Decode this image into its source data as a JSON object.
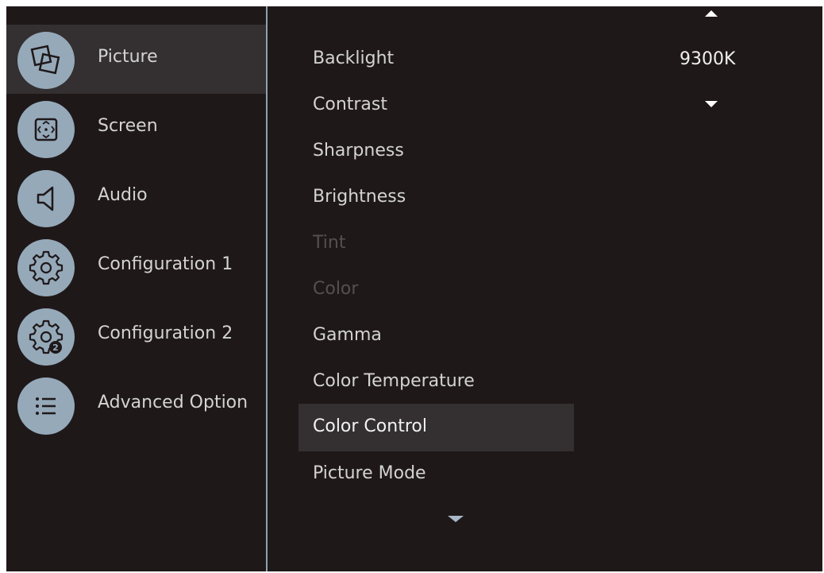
{
  "sidebar": {
    "items": [
      {
        "label": "Picture",
        "icon": "picture-icon",
        "selected": true
      },
      {
        "label": "Screen",
        "icon": "screen-icon",
        "selected": false
      },
      {
        "label": "Audio",
        "icon": "speaker-icon",
        "selected": false
      },
      {
        "label": "Configuration 1",
        "icon": "gear-icon",
        "selected": false
      },
      {
        "label": "Configuration 2",
        "icon": "gear-2-icon",
        "selected": false
      },
      {
        "label": "Advanced Option",
        "icon": "list-icon",
        "selected": false
      }
    ]
  },
  "submenu": {
    "items": [
      {
        "label": "Backlight",
        "enabled": true
      },
      {
        "label": "Contrast",
        "enabled": true
      },
      {
        "label": "Sharpness",
        "enabled": true
      },
      {
        "label": "Brightness",
        "enabled": true
      },
      {
        "label": "Tint",
        "enabled": false
      },
      {
        "label": "Color",
        "enabled": false
      },
      {
        "label": "Gamma",
        "enabled": true
      },
      {
        "label": "Color Temperature",
        "enabled": true
      },
      {
        "label": "Color Control",
        "enabled": true,
        "selected": true
      },
      {
        "label": "Picture Mode",
        "enabled": true
      }
    ],
    "selected_value": "9300K"
  },
  "colors": {
    "background": "#1f1819",
    "divider": "#8ea2b3",
    "icon_circle": "#95a9b9",
    "highlight": "#342f30"
  }
}
